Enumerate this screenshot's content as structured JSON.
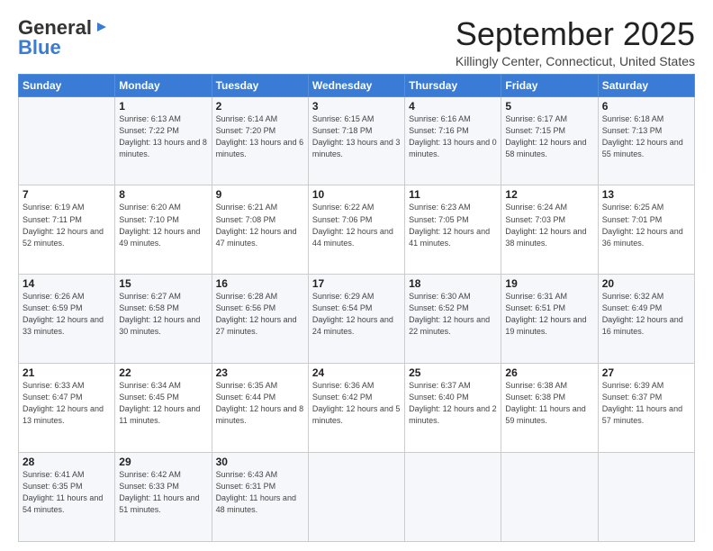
{
  "logo": {
    "general": "General",
    "blue": "Blue"
  },
  "title": "September 2025",
  "subtitle": "Killingly Center, Connecticut, United States",
  "headers": [
    "Sunday",
    "Monday",
    "Tuesday",
    "Wednesday",
    "Thursday",
    "Friday",
    "Saturday"
  ],
  "weeks": [
    [
      {
        "day": "",
        "sunrise": "",
        "sunset": "",
        "daylight": ""
      },
      {
        "day": "1",
        "sunrise": "Sunrise: 6:13 AM",
        "sunset": "Sunset: 7:22 PM",
        "daylight": "Daylight: 13 hours and 8 minutes."
      },
      {
        "day": "2",
        "sunrise": "Sunrise: 6:14 AM",
        "sunset": "Sunset: 7:20 PM",
        "daylight": "Daylight: 13 hours and 6 minutes."
      },
      {
        "day": "3",
        "sunrise": "Sunrise: 6:15 AM",
        "sunset": "Sunset: 7:18 PM",
        "daylight": "Daylight: 13 hours and 3 minutes."
      },
      {
        "day": "4",
        "sunrise": "Sunrise: 6:16 AM",
        "sunset": "Sunset: 7:16 PM",
        "daylight": "Daylight: 13 hours and 0 minutes."
      },
      {
        "day": "5",
        "sunrise": "Sunrise: 6:17 AM",
        "sunset": "Sunset: 7:15 PM",
        "daylight": "Daylight: 12 hours and 58 minutes."
      },
      {
        "day": "6",
        "sunrise": "Sunrise: 6:18 AM",
        "sunset": "Sunset: 7:13 PM",
        "daylight": "Daylight: 12 hours and 55 minutes."
      }
    ],
    [
      {
        "day": "7",
        "sunrise": "Sunrise: 6:19 AM",
        "sunset": "Sunset: 7:11 PM",
        "daylight": "Daylight: 12 hours and 52 minutes."
      },
      {
        "day": "8",
        "sunrise": "Sunrise: 6:20 AM",
        "sunset": "Sunset: 7:10 PM",
        "daylight": "Daylight: 12 hours and 49 minutes."
      },
      {
        "day": "9",
        "sunrise": "Sunrise: 6:21 AM",
        "sunset": "Sunset: 7:08 PM",
        "daylight": "Daylight: 12 hours and 47 minutes."
      },
      {
        "day": "10",
        "sunrise": "Sunrise: 6:22 AM",
        "sunset": "Sunset: 7:06 PM",
        "daylight": "Daylight: 12 hours and 44 minutes."
      },
      {
        "day": "11",
        "sunrise": "Sunrise: 6:23 AM",
        "sunset": "Sunset: 7:05 PM",
        "daylight": "Daylight: 12 hours and 41 minutes."
      },
      {
        "day": "12",
        "sunrise": "Sunrise: 6:24 AM",
        "sunset": "Sunset: 7:03 PM",
        "daylight": "Daylight: 12 hours and 38 minutes."
      },
      {
        "day": "13",
        "sunrise": "Sunrise: 6:25 AM",
        "sunset": "Sunset: 7:01 PM",
        "daylight": "Daylight: 12 hours and 36 minutes."
      }
    ],
    [
      {
        "day": "14",
        "sunrise": "Sunrise: 6:26 AM",
        "sunset": "Sunset: 6:59 PM",
        "daylight": "Daylight: 12 hours and 33 minutes."
      },
      {
        "day": "15",
        "sunrise": "Sunrise: 6:27 AM",
        "sunset": "Sunset: 6:58 PM",
        "daylight": "Daylight: 12 hours and 30 minutes."
      },
      {
        "day": "16",
        "sunrise": "Sunrise: 6:28 AM",
        "sunset": "Sunset: 6:56 PM",
        "daylight": "Daylight: 12 hours and 27 minutes."
      },
      {
        "day": "17",
        "sunrise": "Sunrise: 6:29 AM",
        "sunset": "Sunset: 6:54 PM",
        "daylight": "Daylight: 12 hours and 24 minutes."
      },
      {
        "day": "18",
        "sunrise": "Sunrise: 6:30 AM",
        "sunset": "Sunset: 6:52 PM",
        "daylight": "Daylight: 12 hours and 22 minutes."
      },
      {
        "day": "19",
        "sunrise": "Sunrise: 6:31 AM",
        "sunset": "Sunset: 6:51 PM",
        "daylight": "Daylight: 12 hours and 19 minutes."
      },
      {
        "day": "20",
        "sunrise": "Sunrise: 6:32 AM",
        "sunset": "Sunset: 6:49 PM",
        "daylight": "Daylight: 12 hours and 16 minutes."
      }
    ],
    [
      {
        "day": "21",
        "sunrise": "Sunrise: 6:33 AM",
        "sunset": "Sunset: 6:47 PM",
        "daylight": "Daylight: 12 hours and 13 minutes."
      },
      {
        "day": "22",
        "sunrise": "Sunrise: 6:34 AM",
        "sunset": "Sunset: 6:45 PM",
        "daylight": "Daylight: 12 hours and 11 minutes."
      },
      {
        "day": "23",
        "sunrise": "Sunrise: 6:35 AM",
        "sunset": "Sunset: 6:44 PM",
        "daylight": "Daylight: 12 hours and 8 minutes."
      },
      {
        "day": "24",
        "sunrise": "Sunrise: 6:36 AM",
        "sunset": "Sunset: 6:42 PM",
        "daylight": "Daylight: 12 hours and 5 minutes."
      },
      {
        "day": "25",
        "sunrise": "Sunrise: 6:37 AM",
        "sunset": "Sunset: 6:40 PM",
        "daylight": "Daylight: 12 hours and 2 minutes."
      },
      {
        "day": "26",
        "sunrise": "Sunrise: 6:38 AM",
        "sunset": "Sunset: 6:38 PM",
        "daylight": "Daylight: 11 hours and 59 minutes."
      },
      {
        "day": "27",
        "sunrise": "Sunrise: 6:39 AM",
        "sunset": "Sunset: 6:37 PM",
        "daylight": "Daylight: 11 hours and 57 minutes."
      }
    ],
    [
      {
        "day": "28",
        "sunrise": "Sunrise: 6:41 AM",
        "sunset": "Sunset: 6:35 PM",
        "daylight": "Daylight: 11 hours and 54 minutes."
      },
      {
        "day": "29",
        "sunrise": "Sunrise: 6:42 AM",
        "sunset": "Sunset: 6:33 PM",
        "daylight": "Daylight: 11 hours and 51 minutes."
      },
      {
        "day": "30",
        "sunrise": "Sunrise: 6:43 AM",
        "sunset": "Sunset: 6:31 PM",
        "daylight": "Daylight: 11 hours and 48 minutes."
      },
      {
        "day": "",
        "sunrise": "",
        "sunset": "",
        "daylight": ""
      },
      {
        "day": "",
        "sunrise": "",
        "sunset": "",
        "daylight": ""
      },
      {
        "day": "",
        "sunrise": "",
        "sunset": "",
        "daylight": ""
      },
      {
        "day": "",
        "sunrise": "",
        "sunset": "",
        "daylight": ""
      }
    ]
  ]
}
